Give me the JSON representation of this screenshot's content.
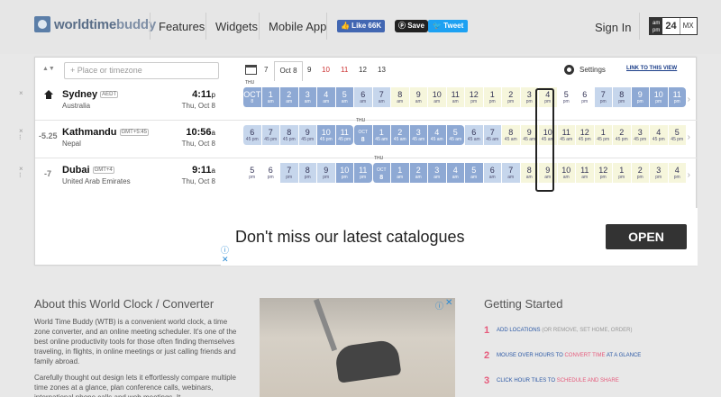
{
  "header": {
    "logo_bold": "worldtime",
    "logo_light": "buddy",
    "nav": [
      "Features",
      "Widgets",
      "Mobile App"
    ],
    "fb_like": "👍 Like 66K",
    "pin_save": "ⓟ Save",
    "tweet": "🐦 Tweet",
    "sign_in": "Sign In",
    "format_ampm": "am pm",
    "format_24": "24",
    "format_mx": "MX"
  },
  "toolbar": {
    "search_placeholder": "Place or timezone",
    "dates": [
      "7",
      "Oct 8",
      "9",
      "10",
      "11",
      "12",
      "13"
    ],
    "settings": "Settings",
    "link_to_view": "LINK TO THIS VIEW"
  },
  "rows": [
    {
      "city": "Sydney",
      "abbr": "AEDT",
      "country": "Australia",
      "time": "4:11",
      "ampm": "p",
      "date": "Thu, Oct 8",
      "offset": ""
    },
    {
      "city": "Kathmandu",
      "abbr": "GMT+5:45",
      "country": "Nepal",
      "time": "10:56",
      "ampm": "a",
      "date": "Thu, Oct 8",
      "offset": "-5.25"
    },
    {
      "city": "Dubai",
      "abbr": "GMT+4",
      "country": "United Arab Emirates",
      "time": "9:11",
      "ampm": "a",
      "date": "Thu, Oct 8",
      "offset": "-7"
    }
  ],
  "thu_label": "THU",
  "ad": {
    "text": "Don't miss our latest catalogues",
    "button": "OPEN"
  },
  "about": {
    "title": "About this World Clock / Converter",
    "p1": "World Time Buddy (WTB) is a convenient world clock, a time zone converter, and an online meeting scheduler. It's one of the best online productivity tools for those often finding themselves traveling, in flights, in online meetings or just calling friends and family abroad.",
    "p2": "Carefully thought out design lets it effortlessly compare multiple time zones at a glance, plan conference calls, webinars, international phone calls and web meetings. It"
  },
  "getting_started": {
    "title": "Getting Started",
    "items": [
      {
        "num": "1",
        "a": "ADD LOCATIONS",
        "b": " (OR REMOVE, SET HOME, ORDER)",
        "c": ""
      },
      {
        "num": "2",
        "a": "MOUSE OVER HOURS TO ",
        "b": "",
        "c": "CONVERT TIME",
        "d": " AT A GLANCE"
      },
      {
        "num": "3",
        "a": "CLICK HOUR TILES TO ",
        "b": "",
        "c": "SCHEDULE AND SHARE",
        "d": ""
      }
    ]
  },
  "colors": {
    "accent": "#8ea9d4",
    "link": "#2b58a5",
    "pink": "#e65a7b"
  }
}
